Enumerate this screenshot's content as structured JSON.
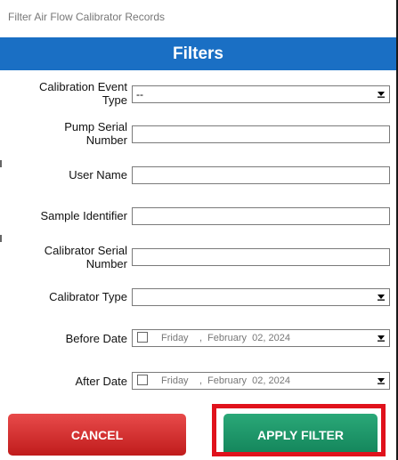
{
  "window": {
    "title": "Filter Air Flow Calibrator Records"
  },
  "header": {
    "title": "Filters"
  },
  "fields": {
    "calibration_event_type": {
      "label_line1": "Calibration Event",
      "label_line2": "Type",
      "value": "--"
    },
    "pump_serial_number": {
      "label_line1": "Pump Serial",
      "label_line2": "Number",
      "value": ""
    },
    "user_name": {
      "label": "User Name",
      "value": ""
    },
    "sample_identifier": {
      "label": "Sample Identifier",
      "value": ""
    },
    "calibrator_serial_number": {
      "label_line1": "Calibrator Serial",
      "label_line2": "Number",
      "value": ""
    },
    "calibrator_type": {
      "label": "Calibrator Type",
      "value": ""
    },
    "before_date": {
      "label": "Before Date",
      "day": "Friday",
      "sep": ",",
      "date": "February  02, 2024"
    },
    "after_date": {
      "label": "After Date",
      "day": "Friday",
      "sep": ",",
      "date": "February  02, 2024"
    }
  },
  "buttons": {
    "cancel": "CANCEL",
    "apply": "APPLY FILTER"
  },
  "colors": {
    "header_bg": "#1a6fc4",
    "cancel_bg": "#d42a2a",
    "apply_bg": "#1a9466",
    "highlight": "#e0121c"
  }
}
